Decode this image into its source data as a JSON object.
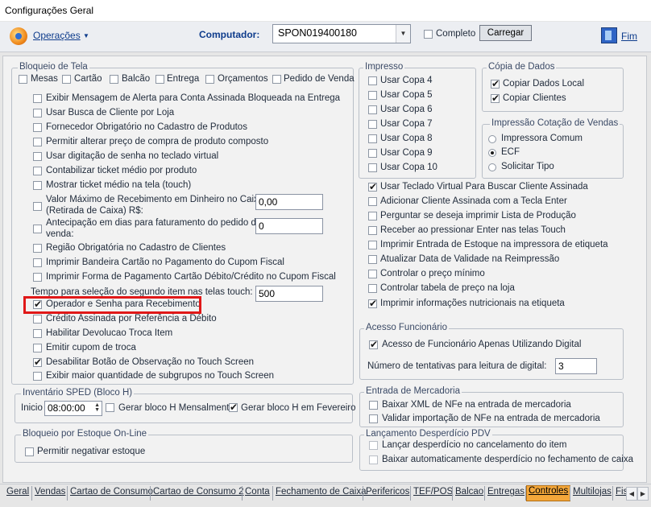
{
  "window": {
    "title": "Configurações Geral"
  },
  "toolbar": {
    "operacoes_label": "Operações",
    "computador_label": "Computador:",
    "computador_value": "SPON019400180",
    "completo_label": "Completo",
    "completo_checked": false,
    "carregar_label": "Carregar",
    "fim_label": "Fim"
  },
  "bloqueio_tela": {
    "title": "Bloqueio de Tela",
    "row": [
      {
        "label": "Mesas",
        "checked": false
      },
      {
        "label": "Cartão",
        "checked": false
      },
      {
        "label": "Balcão",
        "checked": false
      },
      {
        "label": "Entrega",
        "checked": false
      },
      {
        "label": "Orçamentos",
        "checked": false
      },
      {
        "label": "Pedido de Venda",
        "checked": false
      }
    ],
    "options": [
      {
        "label": "Exibir Mensagem de Alerta para Conta Assinada Bloqueada na Entrega",
        "checked": false
      },
      {
        "label": "Usar Busca de Cliente por Loja",
        "checked": false
      },
      {
        "label": "Fornecedor Obrigatório no Cadastro de Produtos",
        "checked": false
      },
      {
        "label": "Permitir alterar preço de compra de produto composto",
        "checked": false
      },
      {
        "label": "Usar digitação de senha no teclado virtual",
        "checked": false
      },
      {
        "label": "Contabilizar ticket médio por produto",
        "checked": false
      },
      {
        "label": "Mostrar ticket médio na tela (touch)",
        "checked": false
      }
    ],
    "valor_maximo_label_1": "Valor Máximo de Recebimento em Dinheiro no Caixa",
    "valor_maximo_label_2": "(Retirada de Caixa) R$:",
    "valor_maximo_value": "0,00",
    "antecipacao_label_1": "Antecipação em dias para faturamento do pedido de",
    "antecipacao_label_2": "venda:",
    "antecipacao_value": "0",
    "options2": [
      {
        "label": "Região Obrigatória no Cadastro de Clientes",
        "checked": false
      },
      {
        "label": "Imprimir Bandeira Cartão no Pagamento do Cupom Fiscal",
        "checked": false
      },
      {
        "label": "Imprimir Forma de Pagamento Cartão Débito/Crédito no Cupom Fiscal",
        "checked": false
      }
    ],
    "tempo_label": "Tempo para seleção do segundo item nas telas touch:",
    "tempo_value": "500",
    "options3": [
      {
        "label": "Operador e Senha para Recebimento",
        "checked": true
      },
      {
        "label": "Crédito Assinada por Referência a Débito",
        "checked": false
      },
      {
        "label": "Habilitar Devolucao Troca Item",
        "checked": false
      },
      {
        "label": "Emitir cupom de troca",
        "checked": false
      },
      {
        "label": "Desabilitar Botão de Observação no Touch Screen",
        "checked": true
      },
      {
        "label": "Exibir maior quantidade de subgrupos no Touch Screen",
        "checked": false
      }
    ]
  },
  "inventario": {
    "title": "Inventário SPED (Bloco H)",
    "inicio_label": "Inicio",
    "inicio_value": "08:00:00",
    "mensal_label": "Gerar bloco H Mensalmente",
    "mensal_checked": false,
    "fevereiro_label": "Gerar bloco H em Fevereiro",
    "fevereiro_checked": true
  },
  "bloqueio_estoque": {
    "title": "Bloqueio por Estoque On-Line",
    "permitir_label": "Permitir negativar estoque",
    "permitir_checked": false
  },
  "impresso": {
    "title": "Impresso",
    "copas": [
      {
        "label": "Usar Copa 4",
        "checked": false
      },
      {
        "label": "Usar Copa 5",
        "checked": false
      },
      {
        "label": "Usar Copa 6",
        "checked": false
      },
      {
        "label": "Usar Copa 7",
        "checked": false
      },
      {
        "label": "Usar Copa 8",
        "checked": false
      },
      {
        "label": "Usar Copa 9",
        "checked": false
      },
      {
        "label": "Usar Copa 10",
        "checked": false
      }
    ],
    "options": [
      {
        "label": "Usar Teclado Virtual Para Buscar Cliente Assinada",
        "checked": true
      },
      {
        "label": "Adicionar Cliente Assinada com a Tecla Enter",
        "checked": false
      },
      {
        "label": "Perguntar se deseja imprimir Lista de Produção",
        "checked": false
      },
      {
        "label": "Receber ao pressionar Enter nas telas Touch",
        "checked": false
      },
      {
        "label": "Imprimir Entrada de Estoque na impressora de etiqueta",
        "checked": false
      },
      {
        "label": "Atualizar Data de Validade na Reimpressão",
        "checked": false
      },
      {
        "label": "Controlar o preço mínimo",
        "checked": false
      },
      {
        "label": "Controlar tabela de preço na loja",
        "checked": false
      },
      {
        "label": "Imprimir informações nutricionais na etiqueta",
        "checked": true
      }
    ]
  },
  "copia_dados": {
    "title": "Cópia de Dados",
    "options": [
      {
        "label": "Copiar Dados Local",
        "checked": true
      },
      {
        "label": "Copiar Clientes",
        "checked": true
      }
    ]
  },
  "impressao_cotacao": {
    "title": "Impressão Cotação de Vendas",
    "options": [
      {
        "label": "Impressora Comum",
        "selected": false
      },
      {
        "label": "ECF",
        "selected": true
      },
      {
        "label": "Solicitar Tipo",
        "selected": false
      }
    ]
  },
  "acesso_funcionario": {
    "title": "Acesso Funcionário",
    "digital_label": "Acesso de Funcionário Apenas Utilizando Digital",
    "digital_checked": true,
    "tentativas_label": "Número de tentativas para leitura de digital:",
    "tentativas_value": "3"
  },
  "entrada_mercadoria": {
    "title": "Entrada de Mercadoria",
    "options": [
      {
        "label": "Baixar XML de NFe na entrada de mercadoria",
        "checked": false
      },
      {
        "label": "Validar importação de NFe na entrada de mercadoria",
        "checked": false
      }
    ]
  },
  "lancamento_desperdicio": {
    "title": "Lançamento Desperdício PDV",
    "options": [
      {
        "label": "Lançar desperdício no cancelamento do item",
        "checked": false
      },
      {
        "label": "Baixar automaticamente desperdício no fechamento de caixa",
        "checked": false
      }
    ]
  },
  "tabs": [
    {
      "label": "Geral",
      "active": false
    },
    {
      "label": "Vendas",
      "active": false
    },
    {
      "label": "Cartao de Consumo",
      "active": false
    },
    {
      "label": "Cartao de Consumo 2",
      "active": false
    },
    {
      "label": "Conta",
      "active": false
    },
    {
      "label": "Fechamento de Caixa",
      "active": false
    },
    {
      "label": "Perifericos",
      "active": false
    },
    {
      "label": "TEF/POS",
      "active": false
    },
    {
      "label": "Balcao",
      "active": false
    },
    {
      "label": "Entregas",
      "active": false
    },
    {
      "label": "Controles",
      "active": true
    },
    {
      "label": "Multilojas",
      "active": false
    },
    {
      "label": "Fis",
      "active": false
    }
  ],
  "colors": {
    "accent_tab": "#f4a73a",
    "highlight_box": "#e01818",
    "title_text": "#0e3c8c"
  }
}
